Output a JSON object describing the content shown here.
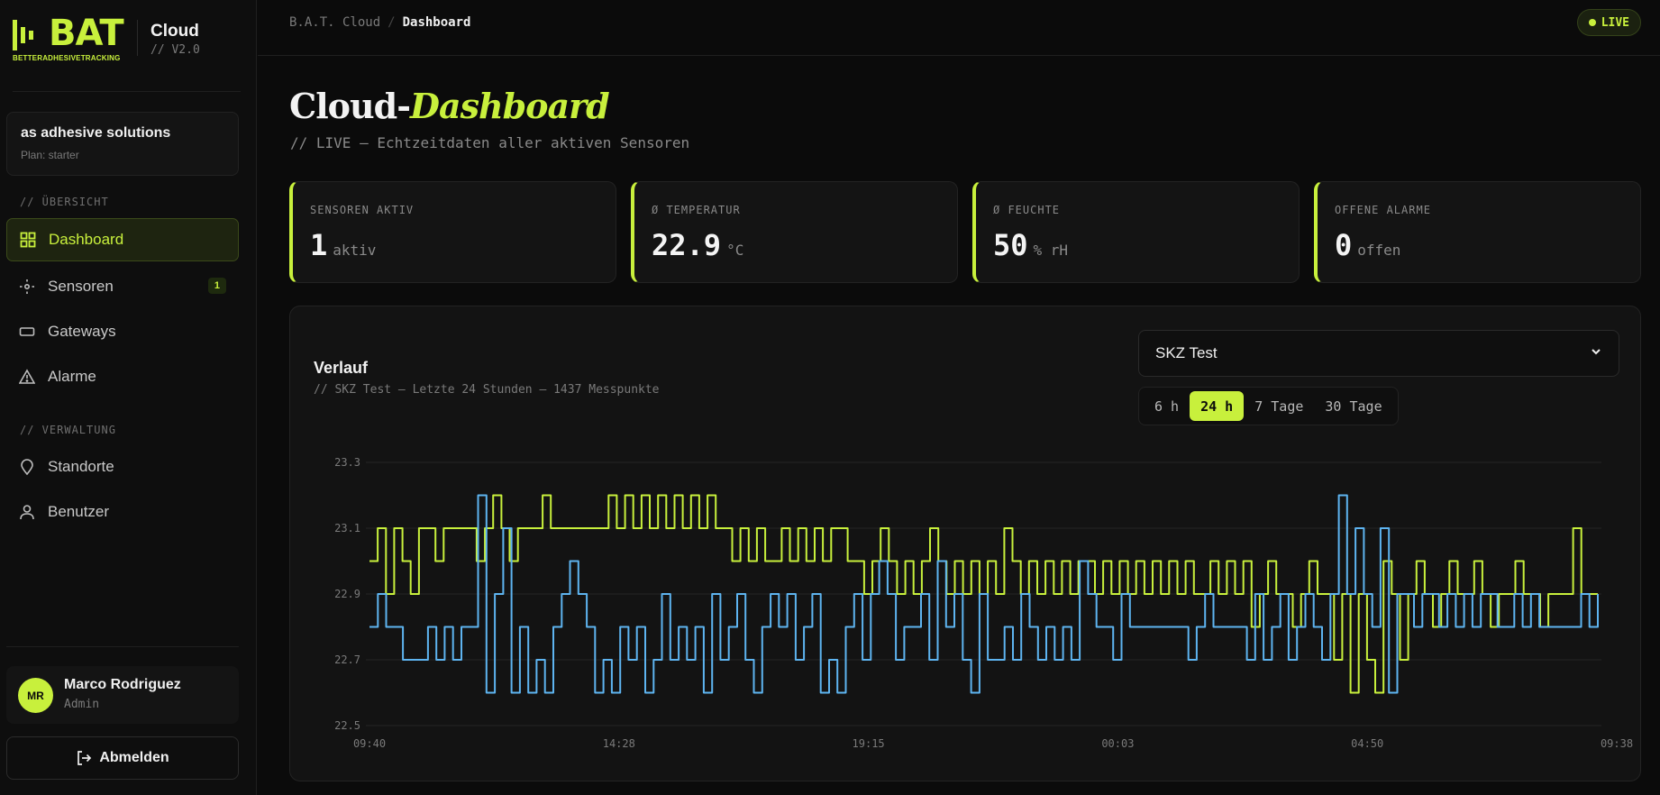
{
  "brand": {
    "logo_word": "BAT",
    "logo_sub": "BETTERADHESIVETRACKING",
    "name": "Cloud",
    "version": "// V2.0"
  },
  "org": {
    "name": "as adhesive solutions",
    "plan": "Plan: starter"
  },
  "nav": {
    "section_overview": "// ÜBERSICHT",
    "section_admin": "// VERWALTUNG",
    "items": [
      {
        "label": "Dashboard",
        "icon": "grid-icon",
        "active": true
      },
      {
        "label": "Sensoren",
        "icon": "sensor-icon",
        "badge": "1"
      },
      {
        "label": "Gateways",
        "icon": "gateway-icon"
      },
      {
        "label": "Alarme",
        "icon": "warning-icon"
      },
      {
        "label": "Standorte",
        "icon": "location-pin-icon"
      },
      {
        "label": "Benutzer",
        "icon": "user-icon"
      }
    ]
  },
  "user": {
    "initials": "MR",
    "name": "Marco Rodriguez",
    "role": "Admin"
  },
  "logout_label": "Abmelden",
  "breadcrumb": {
    "root": "B.A.T. Cloud",
    "separator": "/",
    "current": "Dashboard"
  },
  "live_label": "LIVE",
  "page": {
    "title_main": "Cloud-",
    "title_accent": "Dashboard",
    "subtitle": "// LIVE — Echtzeitdaten aller aktiven Sensoren"
  },
  "stats": [
    {
      "label": "SENSOREN AKTIV",
      "value": "1",
      "unit": "aktiv"
    },
    {
      "label": "Ø TEMPERATUR",
      "value": "22.9",
      "unit": "°C"
    },
    {
      "label": "Ø FEUCHTE",
      "value": "50",
      "unit": "% rH"
    },
    {
      "label": "OFFENE ALARME",
      "value": "0",
      "unit": "offen"
    }
  ],
  "chart_panel": {
    "title": "Verlauf",
    "subtitle": "// SKZ Test — Letzte 24 Stunden — 1437 Messpunkte",
    "selected_sensor": "SKZ Test",
    "ranges": [
      "6 h",
      "24 h",
      "7 Tage",
      "30 Tage"
    ],
    "active_range": "24 h"
  },
  "chart_data": {
    "type": "line",
    "ylim": [
      22.5,
      23.3
    ],
    "y_ticks": [
      "23.3",
      "23.1",
      "22.9",
      "22.7",
      "22.5"
    ],
    "x_ticks": [
      "09:40",
      "14:28",
      "19:15",
      "00:03",
      "04:50",
      "09:38"
    ],
    "grid": true,
    "colors": {
      "accent": "#c8f03c",
      "blue": "#5eb4f0"
    },
    "series": [
      {
        "color": "#c8f03c",
        "values": [
          23.0,
          23.1,
          22.9,
          23.1,
          23.0,
          22.9,
          23.1,
          23.1,
          23.0,
          23.1,
          23.1,
          23.1,
          23.1,
          23.0,
          23.1,
          23.2,
          23.1,
          23.0,
          23.1,
          23.1,
          23.1,
          23.2,
          23.1,
          23.1,
          23.1,
          23.1,
          23.1,
          23.1,
          23.1,
          23.2,
          23.1,
          23.2,
          23.1,
          23.2,
          23.1,
          23.2,
          23.1,
          23.2,
          23.1,
          23.2,
          23.1,
          23.2,
          23.1,
          23.1,
          23.0,
          23.1,
          23.0,
          23.1,
          23.0,
          23.0,
          23.1,
          23.0,
          23.1,
          23.0,
          23.1,
          23.0,
          23.1,
          23.1,
          23.0,
          23.0,
          22.9,
          23.0,
          23.1,
          23.0,
          22.9,
          23.0,
          22.9,
          23.0,
          23.1,
          23.0,
          22.9,
          23.0,
          22.9,
          23.0,
          22.9,
          23.0,
          22.9,
          23.1,
          23.0,
          22.9,
          23.0,
          22.9,
          23.0,
          22.9,
          23.0,
          22.9,
          23.0,
          23.0,
          22.9,
          23.0,
          22.9,
          23.0,
          22.9,
          23.0,
          22.9,
          23.0,
          22.9,
          23.0,
          22.9,
          23.0,
          22.9,
          22.9,
          23.0,
          22.9,
          23.0,
          22.9,
          23.0,
          22.8,
          22.9,
          23.0,
          22.9,
          22.9,
          22.8,
          22.9,
          23.0,
          22.9,
          22.9,
          22.7,
          22.9,
          22.6,
          22.9,
          22.7,
          22.6,
          23.0,
          22.9,
          22.7,
          22.9,
          23.0,
          22.9,
          22.8,
          22.9,
          23.0,
          22.9,
          22.9,
          23.0,
          22.9,
          22.8,
          22.9,
          22.9,
          23.0,
          22.9,
          22.9,
          22.8,
          22.9,
          22.9,
          22.9,
          23.1,
          22.9,
          22.9,
          22.9
        ]
      },
      {
        "color": "#5eb4f0",
        "values": [
          22.8,
          22.9,
          22.8,
          22.8,
          22.7,
          22.7,
          22.7,
          22.8,
          22.7,
          22.8,
          22.7,
          22.8,
          22.8,
          23.2,
          22.6,
          22.9,
          23.1,
          22.6,
          22.8,
          22.6,
          22.7,
          22.6,
          22.8,
          22.9,
          23.0,
          22.9,
          22.8,
          22.6,
          22.7,
          22.6,
          22.8,
          22.7,
          22.8,
          22.6,
          22.7,
          22.9,
          22.7,
          22.8,
          22.7,
          22.8,
          22.6,
          22.9,
          22.7,
          22.8,
          22.9,
          22.7,
          22.6,
          22.8,
          22.9,
          22.8,
          22.9,
          22.7,
          22.8,
          22.9,
          22.6,
          22.7,
          22.6,
          22.8,
          22.9,
          22.7,
          22.9,
          23.0,
          22.9,
          22.7,
          22.8,
          22.8,
          22.9,
          22.7,
          23.0,
          22.8,
          22.9,
          22.7,
          22.6,
          22.9,
          22.7,
          22.7,
          22.8,
          22.7,
          22.9,
          22.8,
          22.7,
          22.8,
          22.7,
          22.8,
          22.7,
          23.0,
          22.9,
          22.8,
          22.8,
          22.7,
          22.9,
          22.8,
          22.8,
          22.8,
          22.8,
          22.8,
          22.8,
          22.8,
          22.7,
          22.8,
          22.9,
          22.8,
          22.8,
          22.8,
          22.8,
          22.7,
          22.9,
          22.7,
          22.8,
          22.9,
          22.7,
          22.8,
          22.9,
          22.8,
          22.7,
          22.9,
          23.2,
          22.9,
          23.1,
          22.9,
          22.8,
          23.1,
          22.6,
          22.9,
          22.9,
          22.8,
          22.9,
          22.9,
          22.8,
          22.9,
          22.8,
          22.9,
          22.8,
          22.9,
          22.9,
          22.8,
          22.8,
          22.9,
          22.8,
          22.9,
          22.8,
          22.8,
          22.8,
          22.8,
          22.8,
          22.9,
          22.8,
          22.9
        ]
      }
    ]
  }
}
